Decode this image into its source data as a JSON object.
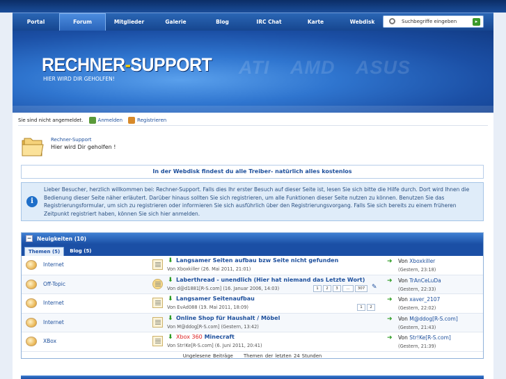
{
  "nav": {
    "items": [
      "Portal",
      "Forum",
      "Mitglieder",
      "Galerie",
      "Blog",
      "IRC Chat",
      "Karte",
      "Webdisk"
    ],
    "active": "Forum"
  },
  "search": {
    "placeholder": "Suchbegriffe eingeben"
  },
  "banner": {
    "logo_left": "RECHNER",
    "logo_dash": "-",
    "logo_right": "SUPPORT",
    "slogan": "HIER WIRD DIR GEHOLFEN!",
    "brands": "ATI AMD ASUS"
  },
  "userbar": {
    "status": "Sie sind nicht angemeldet.",
    "login": "Anmelden",
    "register": "Registrieren"
  },
  "header": {
    "site": "Rechner-Support",
    "tagline": "Hier wird Dir geholfen !"
  },
  "webdisk_notice": "In der Webdisk findest du alle Treiber- natürlich alles kostenlos",
  "info": {
    "text": "Lieber Besucher, herzlich willkommen bei: Rechner-Support. Falls dies Ihr erster Besuch auf dieser Seite ist, lesen Sie sich bitte die Hilfe durch. Dort wird Ihnen die Bedienung dieser Seite näher erläutert. Darüber hinaus sollten Sie sich registrieren, um alle Funktionen dieser Seite nutzen zu können. Benutzen Sie das Registrierungsformular, um sich zu registrieren oder informieren Sie sich ausführlich über den Registrierungsvorgang. Falls Sie sich bereits zu einem früheren Zeitpunkt registriert haben, können Sie sich hier anmelden."
  },
  "news": {
    "title": "Neuigkeiten (10)",
    "toggle": "−",
    "tabs": [
      "Themen (5)",
      "Blog (5)"
    ],
    "rows": [
      {
        "board": "Internet",
        "prefix": "",
        "title": "Langsamer Seiten aufbau bzw Seite nicht gefunden",
        "meta": "Von Xboxkiller (26. Mai 2011, 21:01)",
        "pages": [],
        "last_prefix": "Von ",
        "last_user": "Xboxkiller",
        "last_time": "(Gestern, 23:18)"
      },
      {
        "board": "Off-Topic",
        "prefix": "",
        "title": "Laberthread - unendlich (Hier hat niemand das Letzte Wort)",
        "meta": "Von d@d1881[R-S.com] (16. Januar 2006, 14:03)",
        "pages": [
          "1",
          "2",
          "3",
          "...",
          "307"
        ],
        "last_prefix": "Von ",
        "last_user": "TrAnCeLuDa",
        "last_time": "(Gestern, 22:33)"
      },
      {
        "board": "Internet",
        "prefix": "",
        "title": "Langsamer Seitenaufbau",
        "meta": "Von EvAd088 (19. Mai 2011, 18:09)",
        "pages": [
          "1",
          "2"
        ],
        "last_prefix": "Von ",
        "last_user": "xaver_2107",
        "last_time": "(Gestern, 22:02)"
      },
      {
        "board": "Internet",
        "prefix": "",
        "title": "Online Shop für Haushalt / Möbel",
        "meta": "Von M@ddog[R-S.com] (Gestern, 13:42)",
        "pages": [],
        "last_prefix": "Von ",
        "last_user": "M@ddog[R-S.com]",
        "last_time": "(Gestern, 21:43)"
      },
      {
        "board": "XBox",
        "prefix": "Xbox 360",
        "title": "Minecraft",
        "meta": "Von Str!Ke[R-S.com] (6. Juni 2011, 20:41)",
        "pages": [],
        "last_prefix": "Von ",
        "last_user": "Str!Ke[R-S.com]",
        "last_time": "(Gestern, 21:39)"
      }
    ],
    "footer": [
      "Ungelesene Beiträge",
      "Themen der letzten 24 Stunden"
    ]
  }
}
